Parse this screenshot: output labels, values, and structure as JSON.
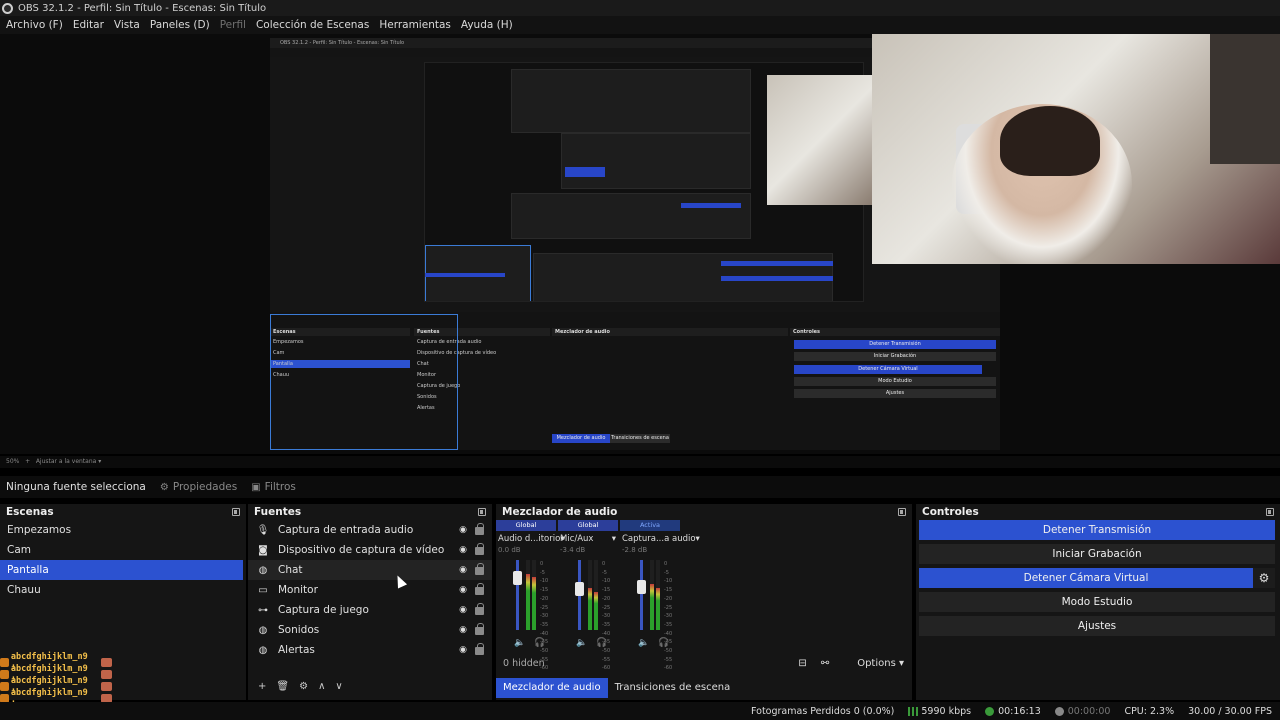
{
  "window": {
    "title": "OBS 32.1.2 - Perfil: Sin Título - Escenas: Sin Título"
  },
  "menubar": {
    "items": [
      {
        "label": "Archivo (F)"
      },
      {
        "label": "Editar"
      },
      {
        "label": "Vista"
      },
      {
        "label": "Paneles (D)"
      },
      {
        "label": "Perfil"
      },
      {
        "label": "Colección de Escenas"
      },
      {
        "label": "Herramientas"
      },
      {
        "label": "Ayuda (H)"
      }
    ]
  },
  "source_toolbar": {
    "no_source": "Ninguna fuente selecciona",
    "properties": "Propiedades",
    "filters": "Filtros"
  },
  "scenes": {
    "title": "Escenas",
    "items": [
      "Empezamos",
      "Cam",
      "Pantalla",
      "Chauu"
    ],
    "selected": "Pantalla"
  },
  "sources": {
    "title": "Fuentes",
    "items": [
      {
        "label": "Captura de entrada audio",
        "icon": "microphone-icon"
      },
      {
        "label": "Dispositivo de captura de vídeo",
        "icon": "camera-icon"
      },
      {
        "label": "Chat",
        "icon": "globe-icon"
      },
      {
        "label": "Monitor",
        "icon": "monitor-icon"
      },
      {
        "label": "Captura de juego",
        "icon": "gamepad-icon"
      },
      {
        "label": "Sonidos",
        "icon": "globe-icon"
      },
      {
        "label": "Alertas",
        "icon": "globe-icon"
      }
    ]
  },
  "mixer": {
    "title": "Mezclador de audio",
    "channels": [
      {
        "tag": "Global",
        "name": "Audio d...itorio",
        "db": "0.0 dB",
        "level": 0.8
      },
      {
        "tag": "Global",
        "name": "Mic/Aux",
        "db": "-3.4 dB",
        "level": 0.6
      },
      {
        "tag": "Activa",
        "name": "Captura...a audio",
        "db": "-2.8 dB",
        "level": 0.65
      }
    ],
    "scale": [
      "0",
      "-5",
      "-10",
      "-15",
      "-20",
      "-25",
      "-30",
      "-35",
      "-40",
      "-45",
      "-50",
      "-55",
      "-60"
    ],
    "hidden": "0 hidden",
    "options": "Options",
    "tabs": [
      "Mezclador de audio",
      "Transiciones de escena"
    ]
  },
  "controls": {
    "title": "Controles",
    "stop_stream": "Detener Transmisión",
    "start_recording": "Iniciar Grabación",
    "stop_virtual_cam": "Detener Cámara Virtual",
    "studio_mode": "Modo Estudio",
    "settings": "Ajustes"
  },
  "chat_overlay": {
    "lines": [
      "abcdfghijklm_n9 :",
      "abcdfghijklm_n9 :",
      "abcdfghijklm_n9 :",
      "abcdfghijklm_n9 :"
    ]
  },
  "preview": {
    "zoom": "50%",
    "fit": "Ajustar a la ventana"
  },
  "statusbar": {
    "dropped_frames": "Fotogramas Perdidos 0 (0.0%)",
    "bitrate": "5990 kbps",
    "stream_time": "00:16:13",
    "rec_time": "00:00:00",
    "cpu": "CPU: 2.3%",
    "fps": "30.00 / 30.00 FPS"
  },
  "colors": {
    "accent": "#2c52d0",
    "background": "#151515"
  }
}
